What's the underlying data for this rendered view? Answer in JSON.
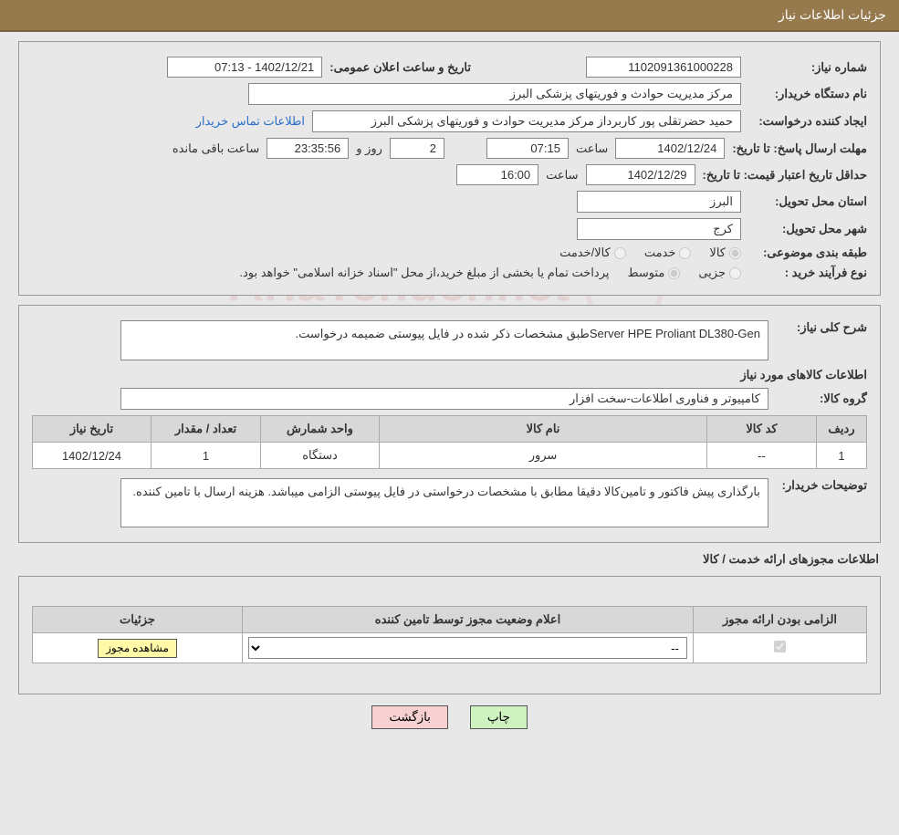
{
  "titleBar": "جزئیات اطلاعات نیاز",
  "labels": {
    "needNo": "شماره نیاز:",
    "announceDT": "تاریخ و ساعت اعلان عمومی:",
    "buyerOrg": "نام دستگاه خریدار:",
    "creator": "ایجاد کننده درخواست:",
    "buyerContact": "اطلاعات تماس خریدار",
    "replyDeadline": "مهلت ارسال پاسخ:",
    "untilDate": "تا تاریخ:",
    "hour": "ساعت",
    "day": "روز و",
    "hoursRemain": "ساعت باقی مانده",
    "minValidity": "حداقل تاریخ اعتبار قیمت:",
    "deliveryProvince": "استان محل تحویل:",
    "deliveryCity": "شهر محل تحویل:",
    "subjectClass": "طبقه بندی موضوعی:",
    "goods": "کالا",
    "service": "خدمت",
    "goodsService": "کالا/خدمت",
    "procType": "نوع فرآیند خرید :",
    "partial": "جزیی",
    "medium": "متوسط",
    "payNote": "پرداخت تمام یا بخشی از مبلغ خرید،از محل \"اسناد خزانه اسلامی\" خواهد بود.",
    "generalDesc": "شرح کلی نیاز:",
    "goodsInfo": "اطلاعات کالاهای مورد نیاز",
    "goodsGroup": "گروه کالا:",
    "buyerNotes": "توضیحات خریدار:",
    "permitsHeading": "اطلاعات مجوزهای ارائه خدمت / کالا",
    "printBtn": "چاپ",
    "backBtn": "بازگشت",
    "viewPermitBtn": "مشاهده مجوز"
  },
  "values": {
    "needNo": "1102091361000228",
    "announceDT": "1402/12/21 - 07:13",
    "buyerOrg": "مرکز مدیریت حوادث و فوریتهای پزشکی البرز",
    "creator": "حمید حضرتقلی پور کاربرداز  مرکز مدیریت حوادث و فوریتهای پزشکی البرز",
    "replyDate": "1402/12/24",
    "replyHour": "07:15",
    "remainDays": "2",
    "remainTime": "23:35:56",
    "validityDate": "1402/12/29",
    "validityHour": "16:00",
    "province": "البرز",
    "city": "کرج",
    "generalDesc": "Server HPE Proliant DL380-Genطبق مشخصات ذکر شده در فایل پیوستی ضمیمه درخواست.",
    "goodsGroup": "کامپیوتر و فناوری اطلاعات-سخت افزار",
    "buyerNotes": "بارگذاری پیش فاکتور و تامین‌کالا دقیقا مطابق با مشخصات درخواستی در فایل پیوستی الزامی میباشد. هزینه ارسال با تامین کننده."
  },
  "subjectSelected": "goods",
  "procTypeSelected": "medium",
  "goodsTable": {
    "headers": {
      "row": "ردیف",
      "code": "کد کالا",
      "name": "نام کالا",
      "unit": "واحد شمارش",
      "qty": "تعداد / مقدار",
      "needDate": "تاریخ نیاز"
    },
    "rows": [
      {
        "row": "1",
        "code": "--",
        "name": "سرور",
        "unit": "دستگاه",
        "qty": "1",
        "needDate": "1402/12/24"
      }
    ]
  },
  "permitTable": {
    "headers": {
      "mandatory": "الزامی بودن ارائه مجوز",
      "status": "اعلام وضعیت مجوز توسط تامین کننده",
      "details": "جزئیات"
    },
    "comboDefault": "--"
  }
}
